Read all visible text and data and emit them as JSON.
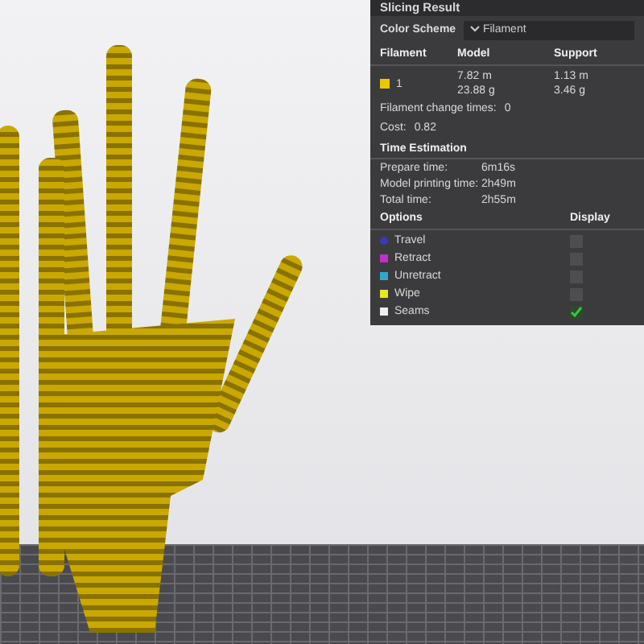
{
  "panel": {
    "title": "Slicing Result",
    "color_scheme_label": "Color Scheme",
    "color_scheme_value": "Filament",
    "columns": [
      "Filament",
      "Model",
      "Support"
    ],
    "filaments": [
      {
        "id": "1",
        "color": "#e8c800",
        "model": [
          "7.82 m",
          "23.88 g"
        ],
        "support": [
          "1.13 m",
          "3.46 g"
        ]
      }
    ],
    "change_times_label": "Filament change times:",
    "change_times": "0",
    "cost_label": "Cost:",
    "cost": "0.82",
    "time_title": "Time Estimation",
    "times": [
      {
        "label": "Prepare time:",
        "value": "6m16s"
      },
      {
        "label": "Model printing time:",
        "value": "2h49m"
      },
      {
        "label": "Total time:",
        "value": "2h55m"
      }
    ],
    "options_columns": [
      "Options",
      "Display"
    ],
    "options": [
      {
        "label": "Travel",
        "color": "#3a3ab8",
        "kind": "dot",
        "checked": false
      },
      {
        "label": "Retract",
        "color": "#c030c8",
        "kind": "square",
        "checked": false
      },
      {
        "label": "Unretract",
        "color": "#30a8c8",
        "kind": "square",
        "checked": false
      },
      {
        "label": "Wipe",
        "color": "#e8e820",
        "kind": "square",
        "checked": false
      },
      {
        "label": "Seams",
        "color": "#eeeeee",
        "kind": "square",
        "checked": true
      }
    ]
  }
}
